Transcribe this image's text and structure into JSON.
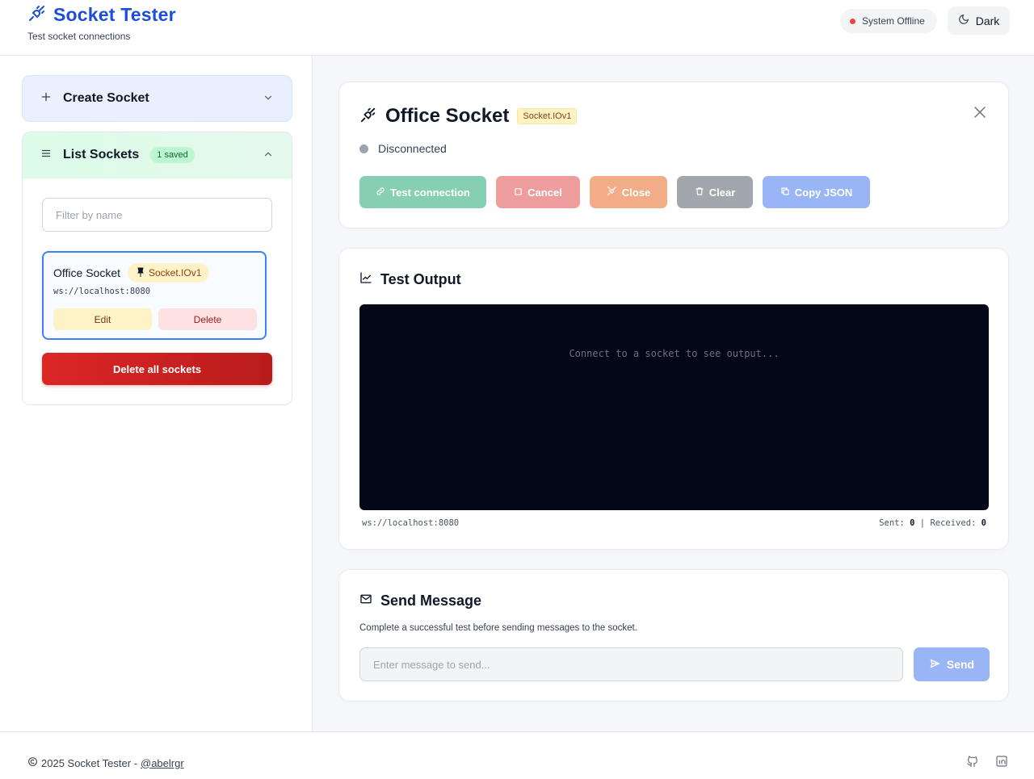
{
  "header": {
    "title": "Socket Tester",
    "subtitle": "Test socket connections",
    "status": "System Offline",
    "theme_toggle": "Dark"
  },
  "sidebar": {
    "create_label": "Create Socket",
    "list_label": "List Sockets",
    "saved_badge": "1 saved",
    "filter_placeholder": "Filter by name",
    "sockets": [
      {
        "name": "Office Socket",
        "type": "Socket.IOv1",
        "url": "ws://localhost:8080",
        "edit_label": "Edit",
        "delete_label": "Delete"
      }
    ],
    "delete_all_label": "Delete all sockets"
  },
  "socket_panel": {
    "name": "Office Socket",
    "type": "Socket.IOv1",
    "status": "Disconnected",
    "actions": {
      "test": "Test connection",
      "cancel": "Cancel",
      "close": "Close",
      "clear": "Clear",
      "copy": "Copy JSON"
    }
  },
  "output": {
    "title": "Test Output",
    "placeholder": "Connect to a socket to see output...",
    "url": "ws://localhost:8080",
    "sent_label": "Sent:",
    "sent": "0",
    "received_label": "Received:",
    "received": "0"
  },
  "send": {
    "title": "Send Message",
    "description": "Complete a successful test before sending messages to the socket.",
    "placeholder": "Enter message to send...",
    "button": "Send"
  },
  "footer": {
    "copyright": "2025 Socket Tester -",
    "author": "@abelrgr"
  },
  "colors": {
    "accent": "#1d4ed8",
    "offline": "#ef4444",
    "terminal_bg": "#020617"
  }
}
